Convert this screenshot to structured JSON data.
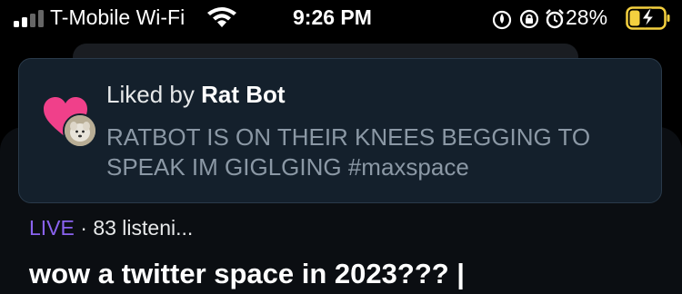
{
  "status_bar": {
    "carrier": "T-Mobile Wi-Fi",
    "time": "9:26 PM",
    "battery_percent": "28%",
    "icons": [
      "signal-icon",
      "wifi-icon",
      "focus-icon",
      "orientation-lock-icon",
      "alarm-icon",
      "battery-charging-icon"
    ]
  },
  "notification": {
    "liked_prefix": "Liked by",
    "liked_user": "Rat Bot",
    "tweet_text": "RATBOT IS ON THEIR KNEES BEGGING TO SPEAK IM GIGLGING #maxspace",
    "icons": [
      "heart-icon",
      "avatar"
    ],
    "colors": {
      "heart": "#f0408a",
      "card_bg": "#14202c"
    }
  },
  "space": {
    "live_label": "LIVE",
    "separator": "·",
    "listeners": "83 listeni...",
    "title": "wow a twitter space in 2023??? |",
    "colors": {
      "live": "#8a63f0"
    }
  }
}
